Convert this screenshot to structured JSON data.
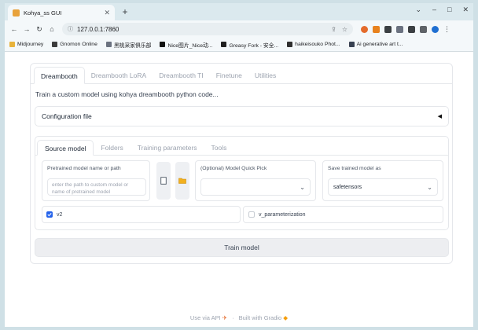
{
  "browser": {
    "tab_title": "Kohya_ss GUI",
    "url": "127.0.0.1:7860",
    "new_tab": "+",
    "bookmarks": [
      {
        "label": "Midjourney",
        "color": "#e8b33b"
      },
      {
        "label": "Gnomon Online",
        "color": "#3b3b3b"
      },
      {
        "label": "黑桃采家俱乐部",
        "color": "#6b7280"
      },
      {
        "label": "Nice图片_Nice动...",
        "color": "#111111"
      },
      {
        "label": "Greasy Fork - 安全...",
        "color": "#1f1f1f"
      },
      {
        "label": "haikeisouko Phot...",
        "color": "#2f2f2f"
      },
      {
        "label": "Ai generative art t...",
        "color": "#374151"
      }
    ]
  },
  "app": {
    "main_tabs": [
      "Dreambooth",
      "Dreambooth LoRA",
      "Dreambooth TI",
      "Finetune",
      "Utilities"
    ],
    "description": "Train a custom model using kohya dreambooth python code...",
    "config_label": "Configuration file",
    "config_toggle": "◀",
    "sub_tabs": [
      "Source model",
      "Folders",
      "Training parameters",
      "Tools"
    ],
    "pretrained_label": "Pretrained model name or path",
    "pretrained_placeholder": "enter the path to custom model or name of pretrained model",
    "quick_pick_label": "(Optional) Model Quick Pick",
    "quick_pick_value": "",
    "save_as_label": "Save trained model as",
    "save_as_value": "safetensors",
    "v2_label": "v2",
    "v2_checked": true,
    "vparam_label": "v_parameterization",
    "vparam_checked": false,
    "train_button": "Train model"
  },
  "footer": {
    "api_text": "Use via API",
    "separator": "·",
    "built_text": "Built with Gradio"
  }
}
